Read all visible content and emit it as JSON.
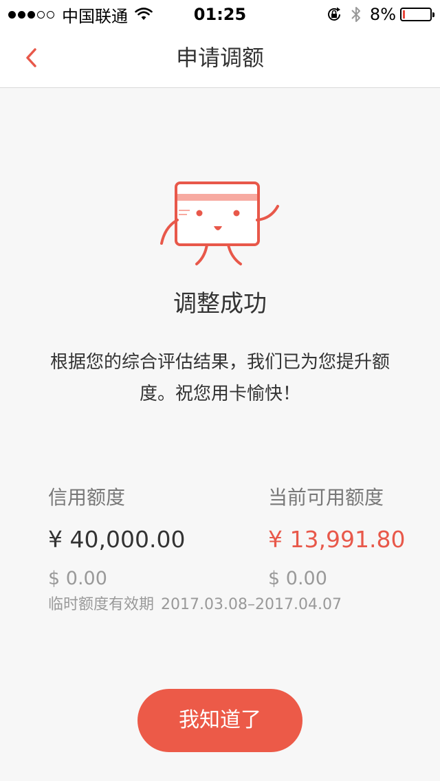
{
  "status_bar": {
    "carrier": "中国联通",
    "time": "01:25",
    "battery_percent": "8%",
    "battery_level": 0.08,
    "signal_bars_filled": 3,
    "signal_bars_total": 5
  },
  "nav": {
    "title": "申请调额",
    "back_icon": "chevron-left-icon"
  },
  "result": {
    "title": "调整成功",
    "description": "根据您的综合评估结果，我们已为您提升额度。祝您用卡愉快！"
  },
  "credit": {
    "limit_label": "信用额度",
    "limit_cny": "¥ 40,000.00",
    "limit_usd": "$ 0.00",
    "available_label": "当前可用额度",
    "available_cny": "¥ 13,991.80",
    "available_usd": "$ 0.00",
    "temp_validity_label": "临时额度有效期",
    "temp_validity_range": "2017.03.08–2017.04.07"
  },
  "confirm_button": "我知道了",
  "colors": {
    "accent": "#ec5a48",
    "accent_text": "#e8584a",
    "background": "#f7f7f7"
  }
}
